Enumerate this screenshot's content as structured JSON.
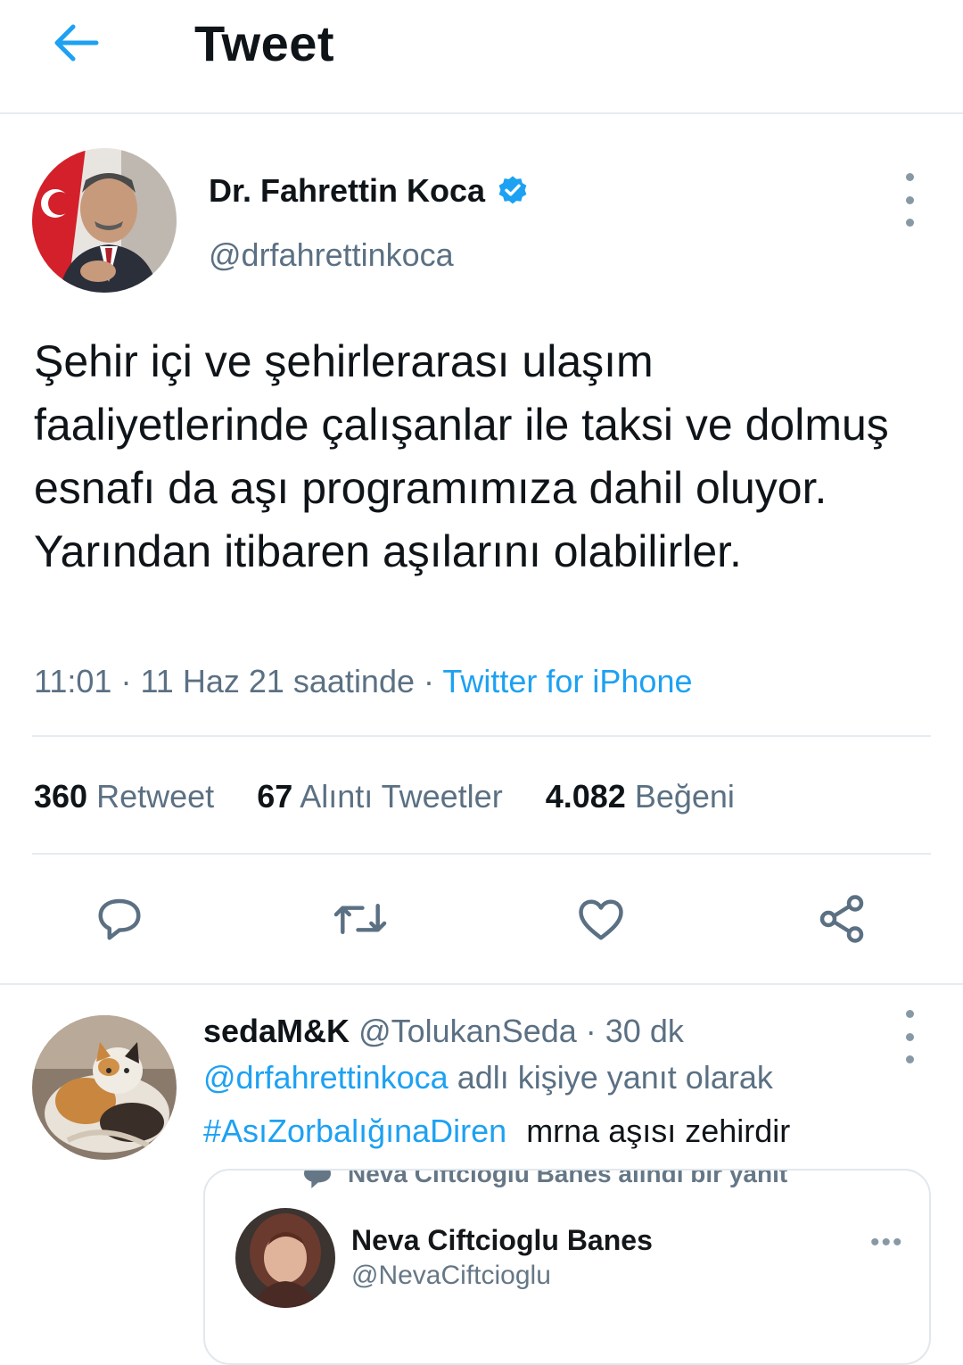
{
  "header": {
    "title": "Tweet",
    "back_icon": "arrow-left-icon",
    "accent": "#1da1f2"
  },
  "tweet": {
    "author": {
      "name": "Dr. Fahrettin Koca",
      "handle": "@drfahrettinkoca",
      "verified": true
    },
    "text": "Şehir içi ve şehirlerarası ulaşım faaliyetlerinde çalışanlar ile taksi ve dolmuş esnafı da aşı programımıza dahil oluyor. Yarından itibaren aşılarını olabilirler.",
    "time": "11:01",
    "date": "11 Haz 21 saatinde",
    "separator": "·",
    "source": "Twitter for iPhone",
    "stats": {
      "retweets": "360",
      "retweets_label": "Retweet",
      "quotes": "67",
      "quotes_label": "Alıntı Tweetler",
      "likes": "4.082",
      "likes_label": "Beğeni"
    },
    "actions": [
      "reply-icon",
      "retweet-icon",
      "like-icon",
      "share-icon"
    ]
  },
  "reply": {
    "name": "sedaM&K",
    "handle": "@TolukanSeda",
    "time": "· 30 dk",
    "mention": "@drfahrettinkoca",
    "reply_suffix": " adlı kişiye yanıt olarak",
    "hashtag": "#AsıZorbalığınaDiren",
    "text": "mrna aşısı zehirdir",
    "quoted": {
      "top_text": "Neva Ciftcioglu Banes alındı bir yanıt",
      "name": "Neva Ciftcioglu Banes",
      "handle": "@NevaCiftcioglu",
      "dots": "•••"
    }
  }
}
